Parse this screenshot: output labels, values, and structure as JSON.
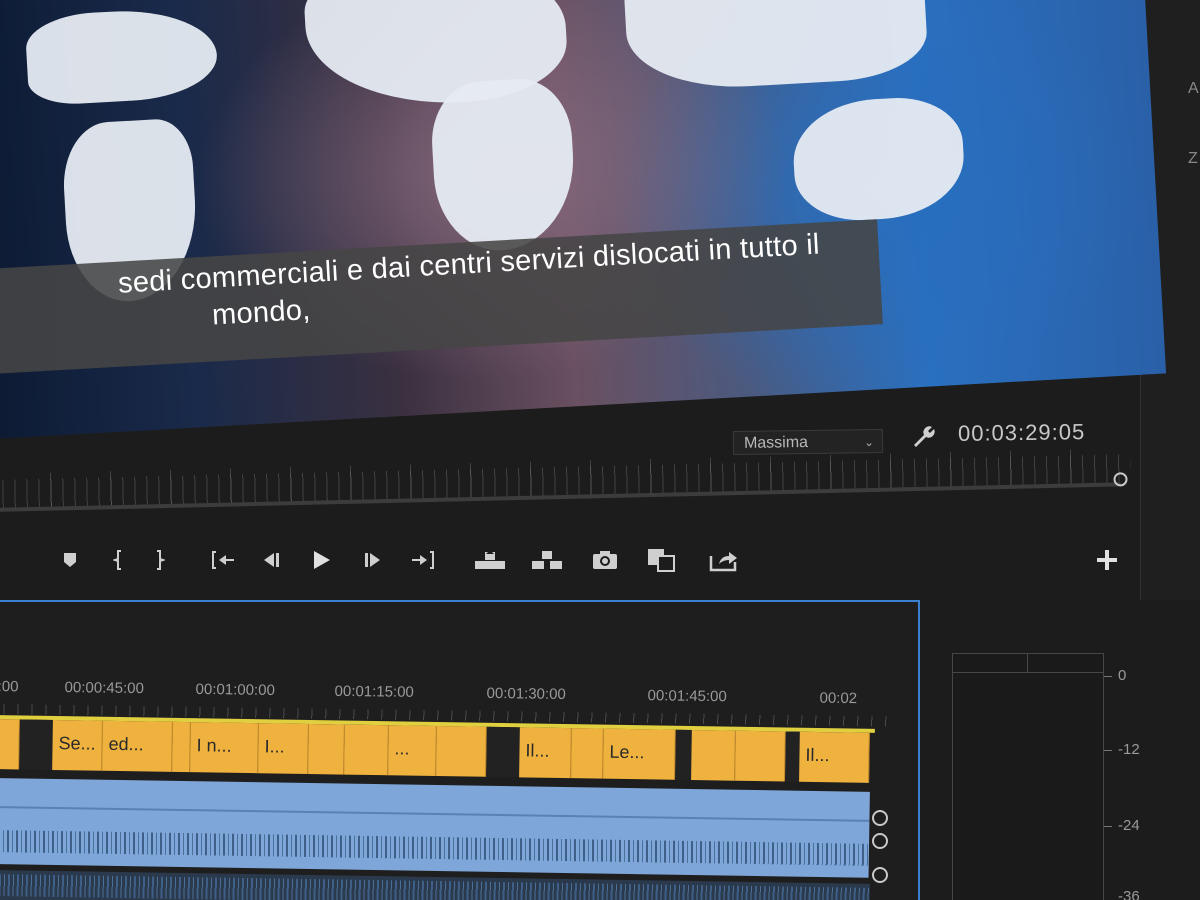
{
  "monitor": {
    "subtitle_line1": "sedi commerciali e dai centri servizi dislocati in tutto il",
    "subtitle_line2": "mondo,",
    "playback_resolution": "Massima",
    "timecode": "00:03:29:05"
  },
  "transport": {
    "buttons": [
      {
        "name": "add-marker-icon"
      },
      {
        "name": "mark-in-icon"
      },
      {
        "name": "mark-out-icon"
      },
      {
        "name": "go-to-in-icon"
      },
      {
        "name": "step-back-icon"
      },
      {
        "name": "play-icon"
      },
      {
        "name": "step-forward-icon"
      },
      {
        "name": "go-to-out-icon"
      },
      {
        "name": "lift-icon"
      },
      {
        "name": "extract-icon"
      },
      {
        "name": "export-frame-icon"
      },
      {
        "name": "comparison-view-icon"
      },
      {
        "name": "share-icon"
      },
      {
        "name": "button-editor-plus-icon"
      }
    ]
  },
  "timeline": {
    "ruler_labels": [
      "00:00:45:00",
      "00:01:00:00",
      "00:01:15:00",
      "00:01:30:00",
      "00:01:45:00",
      "00:02"
    ],
    "ruler_label_partial": ":00",
    "caption_clips": [
      "Se...",
      "ed...",
      "I n...",
      "I...",
      "...",
      "Il...",
      "Le...",
      "Il..."
    ]
  },
  "meter": {
    "labels": [
      "0",
      "-12",
      "-24",
      "-36"
    ]
  },
  "right_panel": {
    "letters": [
      "A",
      "Z"
    ]
  }
}
